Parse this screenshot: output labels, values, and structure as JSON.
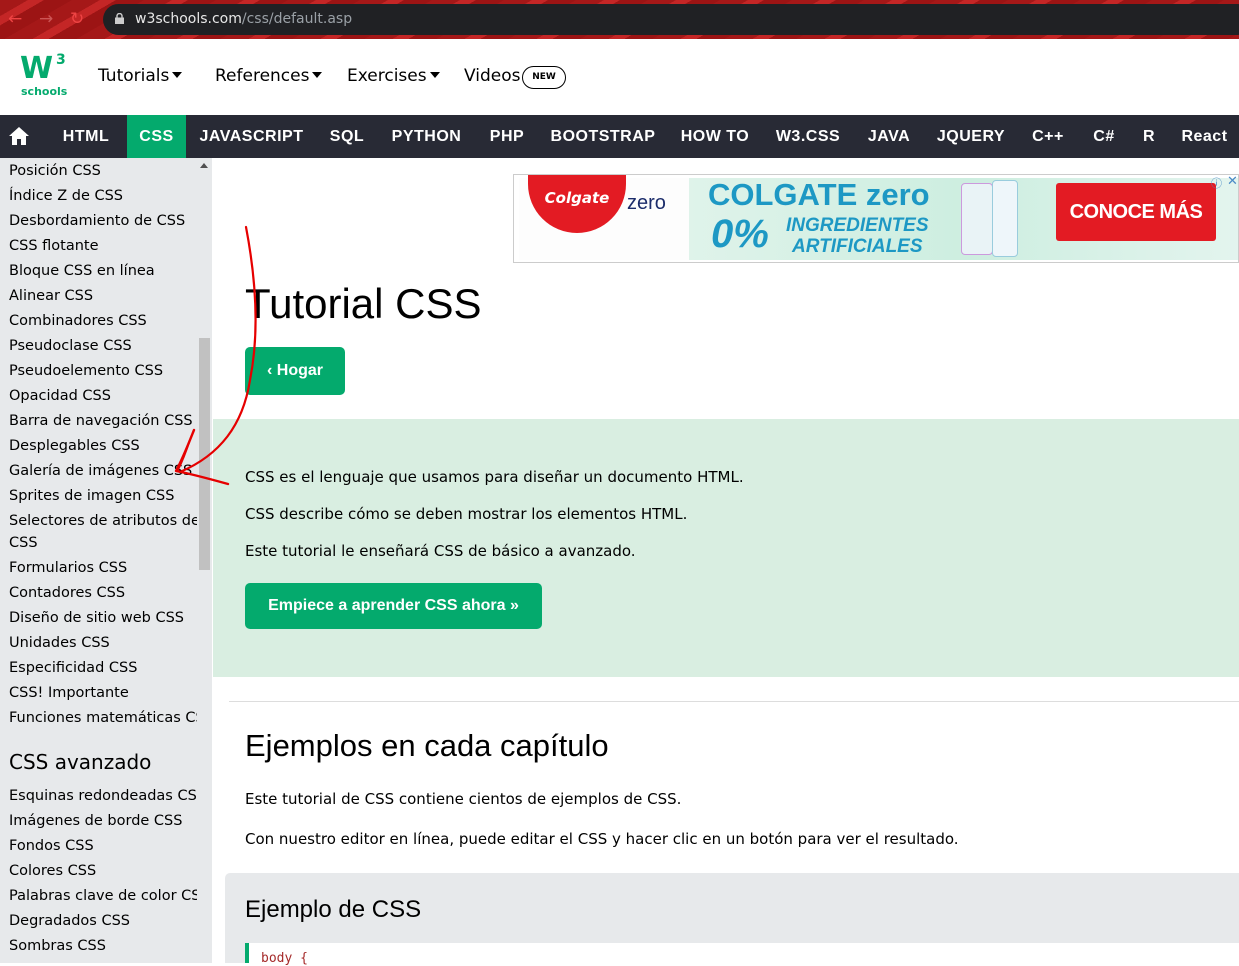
{
  "browser": {
    "url_host": "w3schools.com",
    "url_path": "/css/default.asp"
  },
  "header": {
    "logo_mark": "W",
    "logo_sup": "3",
    "logo_text": "schools",
    "links": [
      "Tutorials",
      "References",
      "Exercises",
      "Videos"
    ],
    "badge": "NEW"
  },
  "topnav": {
    "items": [
      "HTML",
      "CSS",
      "JAVASCRIPT",
      "SQL",
      "PYTHON",
      "PHP",
      "BOOTSTRAP",
      "HOW TO",
      "W3.CSS",
      "JAVA",
      "JQUERY",
      "C++",
      "C#",
      "R",
      "React"
    ],
    "active": "CSS"
  },
  "sidebar": {
    "items": [
      "Posición CSS",
      "Índice Z de CSS",
      "Desbordamiento de CSS",
      "CSS flotante",
      "Bloque CSS en línea",
      "Alinear CSS",
      "Combinadores CSS",
      "Pseudoclase CSS",
      "Pseudoelemento CSS",
      "Opacidad CSS",
      "Barra de navegación CSS",
      "Desplegables CSS",
      "Galería de imágenes CSS",
      "Sprites de imagen CSS",
      "Selectores de atributos de",
      "CSS",
      "Formularios CSS",
      "Contadores CSS",
      "Diseño de sitio web CSS",
      "Unidades CSS",
      "Especificidad CSS",
      "CSS! Importante",
      "Funciones matemáticas CSS"
    ],
    "heading": "CSS avanzado",
    "advanced_items": [
      "Esquinas redondeadas CSS",
      "Imágenes de borde CSS",
      "Fondos CSS",
      "Colores CSS",
      "Palabras clave de color CSS",
      "Degradados CSS",
      "Sombras CSS"
    ]
  },
  "ad": {
    "brand": "Colgate",
    "brand_sub": "zero",
    "headline": "COLGATE zero",
    "percent": "0%",
    "line1": "INGREDIENTES",
    "line2": "ARTIFICIALES",
    "cta": "CONOCE MÁS",
    "choices": "ⓘ",
    "close": "✕"
  },
  "main": {
    "title": "Tutorial CSS",
    "home_button": "Hogar",
    "intro": [
      "CSS es el lenguaje que usamos para diseñar un documento HTML.",
      "CSS describe cómo se deben mostrar los elementos HTML.",
      "Este tutorial le enseñará CSS de básico a avanzado."
    ],
    "start_button": "Empiece a aprender CSS ahora »",
    "section_title": "Ejemplos en cada capítulo",
    "section_p1": "Este tutorial de CSS contiene cientos de ejemplos de CSS.",
    "section_p2": "Con nuestro editor en línea, puede editar el CSS y hacer clic en un botón para ver el resultado.",
    "example_title": "Ejemplo de CSS",
    "code_line": "body {"
  },
  "colors": {
    "accent": "#04aa6d",
    "nav_bg": "#282a35",
    "sidebar_bg": "#e7e9eb",
    "intro_bg": "#d9eee1",
    "annotation": "#e60000"
  }
}
